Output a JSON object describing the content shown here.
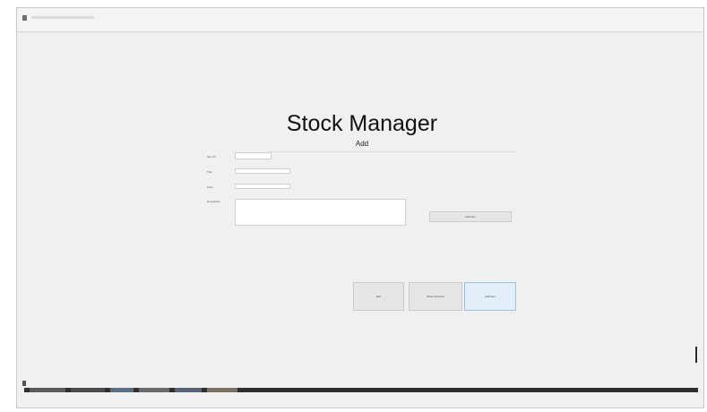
{
  "window": {
    "title": ""
  },
  "header": {
    "title": "Stock Manager",
    "subtitle": "Add"
  },
  "form": {
    "fields": [
      {
        "label": "Item ID",
        "value": ""
      },
      {
        "label": "Title",
        "value": ""
      },
      {
        "label": "Price",
        "value": ""
      },
      {
        "label": "Description",
        "value": ""
      }
    ],
    "side_button_label": "Add Item"
  },
  "actions": {
    "buttons": [
      {
        "label": "Exit"
      },
      {
        "label": "Show All Items"
      },
      {
        "label": "Add Item"
      }
    ]
  },
  "colors": {
    "window_bg": "#f0f0f0",
    "focused_button_bg": "#e4eef8",
    "taskbar": "#2f2f2f"
  }
}
